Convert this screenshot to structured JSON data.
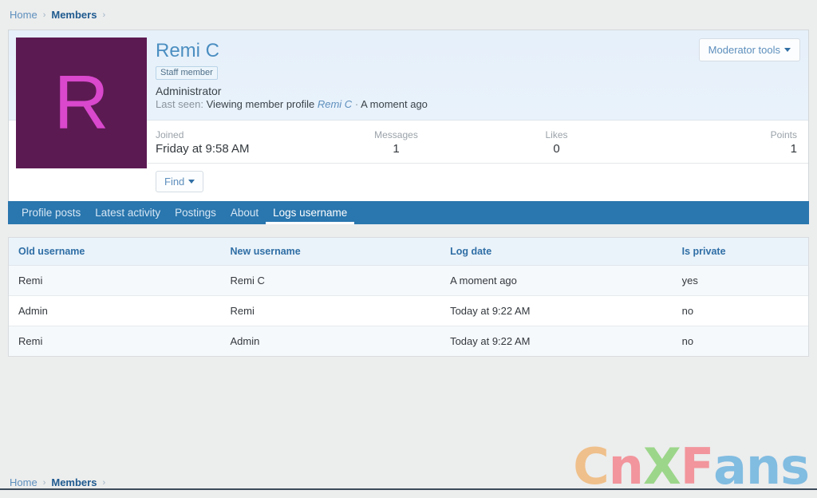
{
  "breadcrumb": {
    "items": [
      {
        "label": "Home",
        "strong": false
      },
      {
        "label": "Members",
        "strong": true
      }
    ],
    "separator": "›"
  },
  "profile": {
    "avatar_letter": "R",
    "avatar_bg": "#5c1a52",
    "avatar_fg": "#d948cd",
    "name": "Remi C",
    "staff_badge": "Staff member",
    "user_title": "Administrator",
    "last_seen_label": "Last seen:",
    "last_seen_activity": "Viewing member profile",
    "last_seen_user": "Remi C",
    "last_seen_dot": "·",
    "last_seen_time": "A moment ago",
    "moderator_tools_label": "Moderator tools",
    "find_label": "Find"
  },
  "stats": [
    {
      "label": "Joined",
      "value": "Friday at 9:58 AM"
    },
    {
      "label": "Messages",
      "value": "1"
    },
    {
      "label": "Likes",
      "value": "0"
    },
    {
      "label": "Points",
      "value": "1"
    }
  ],
  "tabs": [
    {
      "label": "Profile posts",
      "active": false
    },
    {
      "label": "Latest activity",
      "active": false
    },
    {
      "label": "Postings",
      "active": false
    },
    {
      "label": "About",
      "active": false
    },
    {
      "label": "Logs username",
      "active": true
    }
  ],
  "table": {
    "headers": [
      "Old username",
      "New username",
      "Log date",
      "Is private"
    ],
    "rows": [
      [
        "Remi",
        "Remi C",
        "A moment ago",
        "yes"
      ],
      [
        "Admin",
        "Remi",
        "Today at 9:22 AM",
        "no"
      ],
      [
        "Remi",
        "Admin",
        "Today at 9:22 AM",
        "no"
      ]
    ]
  },
  "footer_breadcrumb": {
    "items": [
      {
        "label": "Home",
        "strong": false
      },
      {
        "label": "Members",
        "strong": true
      }
    ],
    "separator": "›"
  },
  "watermark": {
    "letters": [
      {
        "char": "C",
        "color": "#f0b97a"
      },
      {
        "char": "n",
        "color": "#f4868f"
      },
      {
        "char": "X",
        "color": "#8fd27a"
      },
      {
        "char": "F",
        "color": "#f4868f"
      },
      {
        "char": "a",
        "color": "#6fb4e0"
      },
      {
        "char": "n",
        "color": "#6fb4e0"
      },
      {
        "char": "s",
        "color": "#6fb4e0"
      }
    ],
    "text": "CnXFans"
  },
  "theme": {
    "accent_blue": "#2a76ae",
    "link_blue": "#5d8fbd",
    "page_bg": "#eceded",
    "header_bg": "#e8f1fa"
  }
}
